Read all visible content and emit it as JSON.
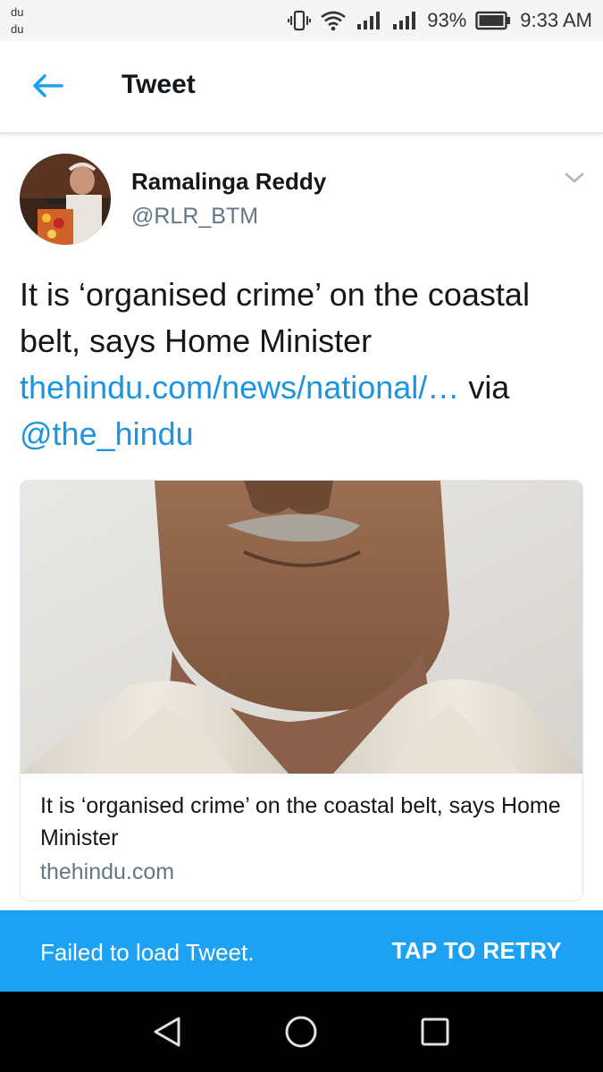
{
  "status_bar": {
    "carrier_line1": "du",
    "carrier_line2": "du",
    "battery_percent": "93%",
    "time": "9:33 AM",
    "icons": [
      "vibrate-icon",
      "wifi-icon",
      "signal-icon",
      "signal-icon",
      "battery-icon"
    ]
  },
  "app_bar": {
    "title": "Tweet",
    "back_icon": "arrow-left-icon"
  },
  "tweet": {
    "author_name": "Ramalinga Reddy",
    "author_handle": "@RLR_BTM",
    "text_part1": "It is ‘organised crime’ on the coastal belt, says Home Minister",
    "link": "thehindu.com/news/national/…",
    "via_text": "via",
    "mention": "@the_hindu",
    "caret_icon": "chevron-down-icon"
  },
  "card": {
    "title": "It is ‘organised crime’ on the coastal belt, says Home Minister",
    "domain": "thehindu.com"
  },
  "error_bar": {
    "message": "Failed to load Tweet.",
    "action": "TAP TO RETRY"
  },
  "colors": {
    "accent": "#1da1f2",
    "link": "#1b95e0",
    "text": "#14171a",
    "secondary_text": "#657786"
  },
  "nav_bar": {
    "icons": [
      "back-triangle-icon",
      "home-circle-icon",
      "recents-square-icon"
    ]
  }
}
